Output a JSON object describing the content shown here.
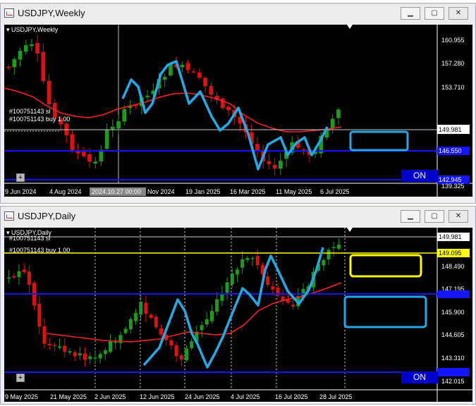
{
  "windows": [
    {
      "title": "USDJPY,Weekly",
      "symbol_label": "USDJPY,Weekly",
      "prices": [
        "160.955",
        "157.280",
        "153.710",
        "149.981",
        "146.550",
        "142.945",
        "139.325"
      ],
      "current_price": "149.981",
      "orders": [
        "#100751143 sl",
        "#100751143 buy 1.00"
      ],
      "dates": [
        "9 Jun 2024",
        "4 Aug 2024",
        "2024.10.27 00:00",
        "Nov 2024",
        "19 Jan 2025",
        "16 Mar 2025",
        "11 May 2025",
        "6 Jul 2025"
      ],
      "on_label": "ON",
      "plus_label": "+"
    },
    {
      "title": "USDJPY,Daily",
      "symbol_label": "USDJPY,Daily",
      "prices": [
        "149.981",
        "149.095",
        "148.490",
        "147.195",
        "145.900",
        "144.605",
        "143.310",
        "142.015"
      ],
      "current_price": "149.981",
      "order_price": "149.095",
      "orders": [
        "#100751143 sl",
        "#100751143 buy 1.00"
      ],
      "dates": [
        "9 May 2025",
        "21 May 2025",
        "2 Jun 2025",
        "12 Jun 2025",
        "24 Jun 2025",
        "4 Jul 2025",
        "16 Jul 2025",
        "28 Jul 2025"
      ],
      "on_label": "ON",
      "plus_label": "+"
    }
  ],
  "colors": {
    "bull": "#1e9a1e",
    "bear": "#e01010",
    "ma": "#ff2020",
    "hline": "#1414ff",
    "sketch": "#23a9e6",
    "order": "#ffff00",
    "box_blue": "#23a9e6",
    "box_yellow": "#ffff00"
  },
  "buttons": {
    "minimize": "▁",
    "maximize": "▢",
    "close": "✕"
  }
}
